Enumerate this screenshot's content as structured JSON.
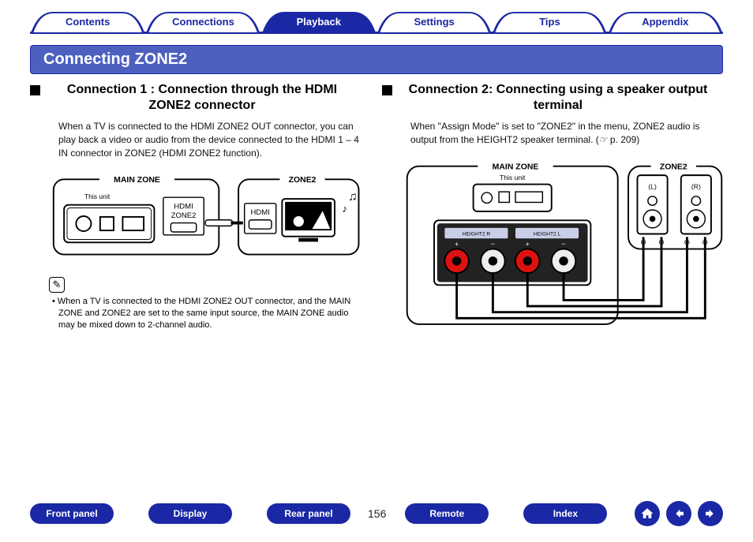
{
  "nav": {
    "tabs": [
      "Contents",
      "Connections",
      "Playback",
      "Settings",
      "Tips",
      "Appendix"
    ],
    "active_index": 2
  },
  "section_title": "Connecting ZONE2",
  "left": {
    "heading": "Connection 1 : Connection through the HDMI ZONE2 connector",
    "body": "When a TV is connected to the HDMI ZONE2 OUT connector, you can play back a video or audio from the device connected to the HDMI 1 – 4 IN connector in ZONE2 (HDMI ZONE2 function).",
    "diagram": {
      "main_zone_label": "MAIN ZONE",
      "zone2_label": "ZONE2",
      "unit_label": "This unit",
      "hdmi_zone2_label": "HDMI\nZONE2",
      "hdmi_label": "HDMI"
    },
    "note_icon": "✎",
    "note": "When a TV is connected to the HDMI ZONE2 OUT connector, and the MAIN ZONE and ZONE2 are set to the same input source, the MAIN ZONE audio may be mixed down to 2-channel audio."
  },
  "right": {
    "heading": "Connection 2: Connecting using a speaker output terminal",
    "body_prefix": "When \"Assign Mode\" is set to \"ZONE2\" in the menu, ZONE2 audio is output from the HEIGHT2 speaker terminal.  (",
    "body_link_icon": "☞",
    "body_link": "p. 209",
    "body_suffix": ")",
    "diagram": {
      "main_zone_label": "MAIN ZONE",
      "zone2_label": "ZONE2",
      "unit_label": "This unit",
      "speaker_left": "(L)",
      "speaker_right": "(R)",
      "panel_left": "HEIGHT2 R",
      "panel_right": "HEIGHT2 L"
    }
  },
  "page_number": "156",
  "bottom": {
    "buttons": [
      "Front panel",
      "Display",
      "Rear panel",
      "Remote",
      "Index"
    ],
    "home_icon": "home-icon",
    "prev_icon": "arrow-left-icon",
    "next_icon": "arrow-right-icon"
  }
}
